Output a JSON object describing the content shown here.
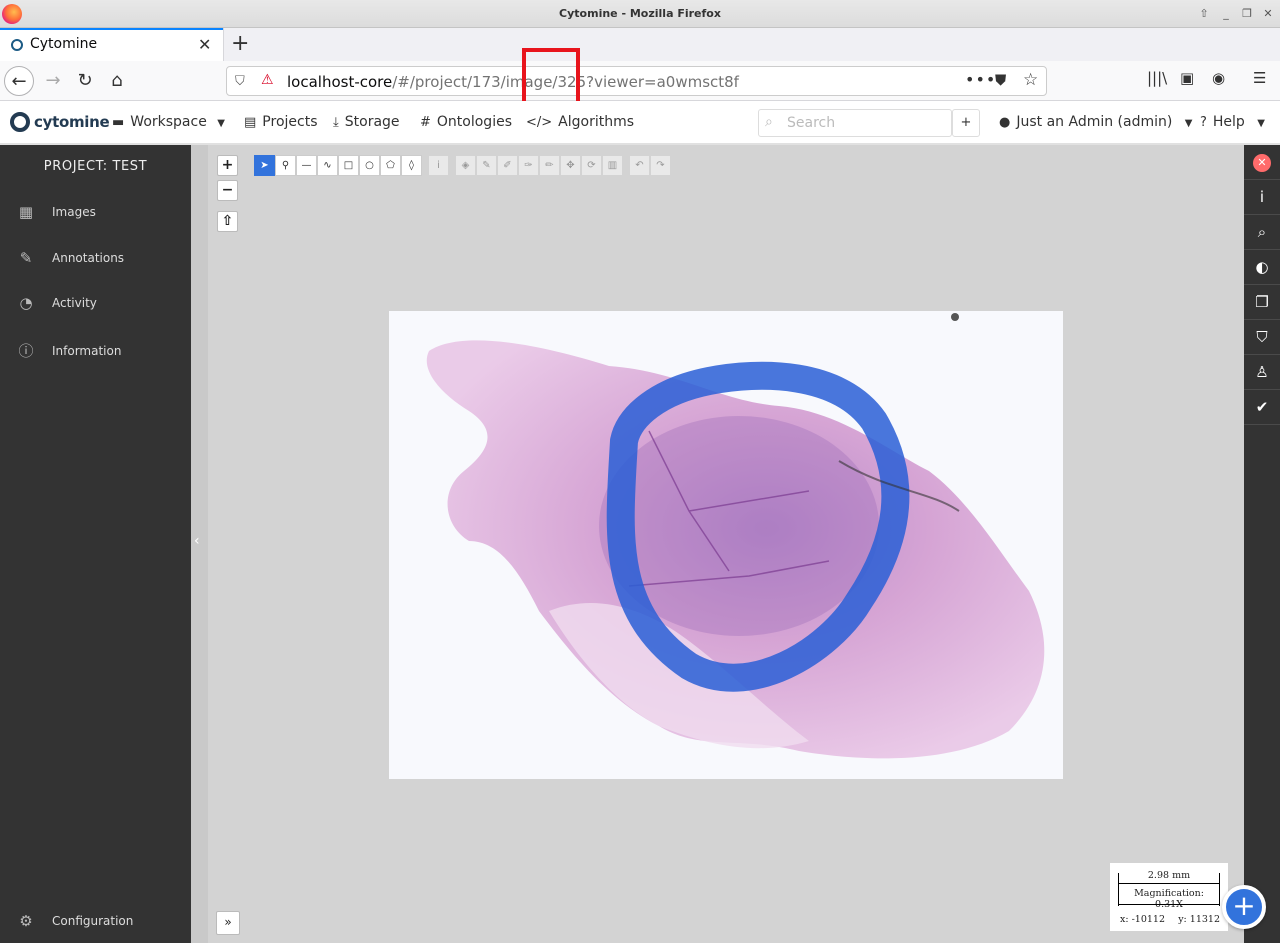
{
  "window": {
    "title": "Cytomine - Mozilla Firefox"
  },
  "browser": {
    "tab_title": "Cytomine",
    "url_host": "localhost-core",
    "url_path": "/#/project/173/image/325?viewer=a0wmsct8f"
  },
  "appnav": {
    "brand": "cytomine",
    "workspace": "Workspace",
    "projects": "Projects",
    "storage": "Storage",
    "ontologies": "Ontologies",
    "algorithms": "Algorithms",
    "search_placeholder": "Search",
    "add_label": "+",
    "user": "Just an Admin (admin)",
    "help": "Help"
  },
  "sidebar": {
    "project_title": "PROJECT: TEST",
    "items": [
      {
        "label": "Images",
        "icon": "images-icon"
      },
      {
        "label": "Annotations",
        "icon": "edit-icon"
      },
      {
        "label": "Activity",
        "icon": "dashboard-icon"
      },
      {
        "label": "Information",
        "icon": "info-circle-icon"
      }
    ],
    "configuration": "Configuration"
  },
  "viewer": {
    "zoom_in": "+",
    "zoom_out": "−",
    "rotate_up": "⇧",
    "scale_length": "2.98 mm",
    "magnification": "Magnification: 0.31X",
    "coord_x": "x: -10112",
    "coord_y": "y: 11312",
    "expand": "»",
    "fab": "+"
  },
  "colors": {
    "accent": "#3273dc",
    "sidebar_bg": "#333333",
    "highlight": "#e8141c",
    "tissue_pink": "#d4a0d0",
    "marker_blue": "#2a5fd6"
  }
}
